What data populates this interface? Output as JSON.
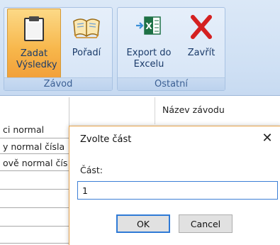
{
  "ribbon": {
    "groups": [
      {
        "label": "Závod",
        "buttons": [
          {
            "label": "Zadat Výsledky",
            "icon": "clipboard-icon",
            "active": true
          },
          {
            "label": "Pořadí",
            "icon": "book-icon"
          }
        ]
      },
      {
        "label": "Ostatní",
        "buttons": [
          {
            "label": "Export do Excelu",
            "icon": "excel-export-icon"
          },
          {
            "label": "Zavřít",
            "icon": "close-x-icon"
          }
        ]
      }
    ]
  },
  "table": {
    "header_right": "Název závodu",
    "rows": [
      "ci normal",
      "y normal čísla",
      "ově normal čís",
      "",
      "",
      "",
      ""
    ]
  },
  "dialog": {
    "title": "Zvolte část",
    "close": "✕",
    "field_label": "Část:",
    "field_value": "1",
    "ok_label": "OK",
    "cancel_label": "Cancel"
  },
  "colors": {
    "accent_orange": "#f7b64a",
    "ribbon_blue": "#d5e4f6",
    "excel_green": "#1e7145",
    "close_red": "#d42020",
    "input_focus": "#3c7fd6"
  }
}
